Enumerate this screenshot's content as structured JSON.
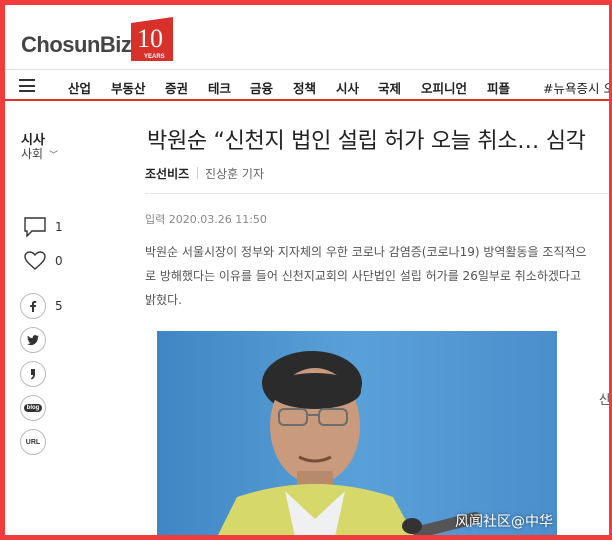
{
  "header": {
    "logo_text": "ChosunBiz",
    "badge_number": "10",
    "badge_label": "YEARS"
  },
  "nav": {
    "items": [
      "산업",
      "부동산",
      "증권",
      "테크",
      "금융",
      "정책",
      "시사",
      "국제",
      "오피니언",
      "피플"
    ],
    "trending": "#뉴욕증시 오"
  },
  "rail": {
    "section": "시사",
    "subsection": "사회",
    "comment_count": "1",
    "like_count": "0",
    "facebook_count": "5",
    "blog_label": "blog",
    "url_label": "URL"
  },
  "article": {
    "headline": "박원순 “신천지 법인 설립 허가 오늘 취소… 심각",
    "publisher": "조선비즈",
    "author": "진상훈 기자",
    "pubdate": "입력 2020.03.26 11:50",
    "lede": "박원순 서울시장이 정부와 지자체의 우한 코로나 감염증(코로나19) 방역활동을 조직적으로 방해했다는 이유를 들어 신천지교회의 사단법인 설립 허가를 26일부로 취소하겠다고 밝혔다."
  },
  "watermark": "风闻社区@中华",
  "side_peek": "산",
  "colors": {
    "frame_border": "#f03c3c",
    "brand_red": "#e3322b",
    "photo_bg": "#4a8ec8",
    "vest": "#d6d86a"
  }
}
